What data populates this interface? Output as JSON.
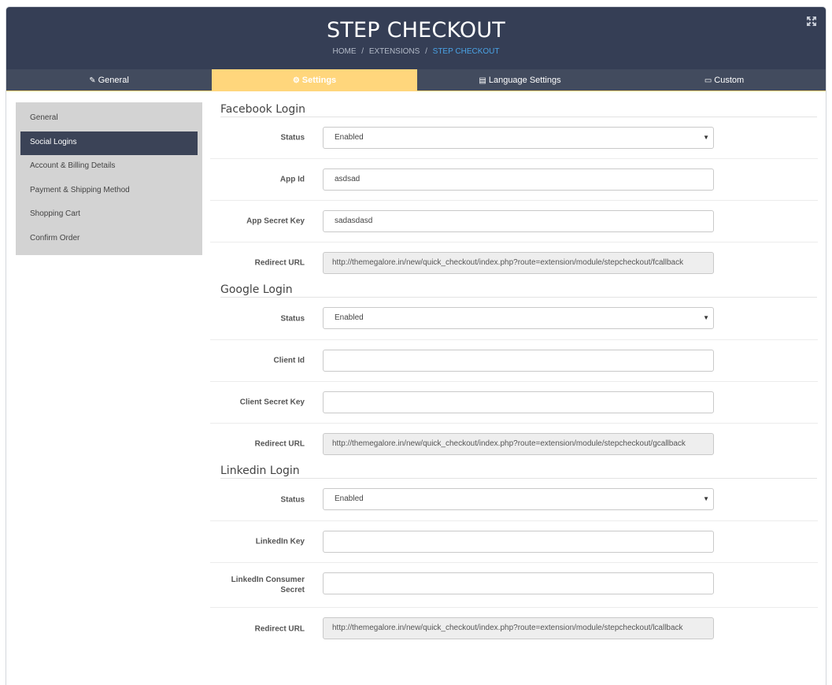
{
  "header": {
    "title": "STEP CHECKOUT",
    "breadcrumb": {
      "home": "HOME",
      "separator": "/",
      "extensions": "EXTENSIONS",
      "current": "STEP CHECKOUT"
    },
    "expand_icon": "expand-arrows-icon"
  },
  "tabs": [
    {
      "label": "General",
      "icon": "edit-icon"
    },
    {
      "label": "Settings",
      "icon": "gear-icon"
    },
    {
      "label": "Language Settings",
      "icon": "language-icon"
    },
    {
      "label": "Custom",
      "icon": "monitor-icon"
    }
  ],
  "sidebar": {
    "items": [
      {
        "label": "General"
      },
      {
        "label": "Social Logins"
      },
      {
        "label": "Account & Billing Details"
      },
      {
        "label": "Payment & Shipping Method"
      },
      {
        "label": "Shopping Cart"
      },
      {
        "label": "Confirm Order"
      }
    ],
    "active_index": 1
  },
  "facebook": {
    "title": "Facebook Login",
    "status_label": "Status",
    "status_value": "Enabled",
    "app_id_label": "App Id",
    "app_id_value": "asdsad",
    "secret_label": "App Secret Key",
    "secret_value": "sadasdasd",
    "redirect_label": "Redirect URL",
    "redirect_value": "http://themegalore.in/new/quick_checkout/index.php?route=extension/module/stepcheckout/fcallback"
  },
  "google": {
    "title": "Google Login",
    "status_label": "Status",
    "status_value": "Enabled",
    "client_id_label": "Client Id",
    "client_id_value": "",
    "secret_label": "Client Secret Key",
    "secret_value": "",
    "redirect_label": "Redirect URL",
    "redirect_value": "http://themegalore.in/new/quick_checkout/index.php?route=extension/module/stepcheckout/gcallback"
  },
  "linkedin": {
    "title": "Linkedin Login",
    "status_label": "Status",
    "status_value": "Enabled",
    "key_label": "LinkedIn Key",
    "key_value": "",
    "secret_label": "LinkedIn Consumer Secret",
    "secret_value": "",
    "redirect_label": "Redirect URL",
    "redirect_value": "http://themegalore.in/new/quick_checkout/index.php?route=extension/module/stepcheckout/lcallback"
  },
  "colors": {
    "header_bg": "#353e55",
    "tab_bar_bg": "#424b5e",
    "active_tab_bg": "#ffd67c",
    "breadcrumb_active": "#4aa3e6",
    "sidebar_bg": "#d3d3d3",
    "sidebar_active_bg": "#3b4357"
  }
}
